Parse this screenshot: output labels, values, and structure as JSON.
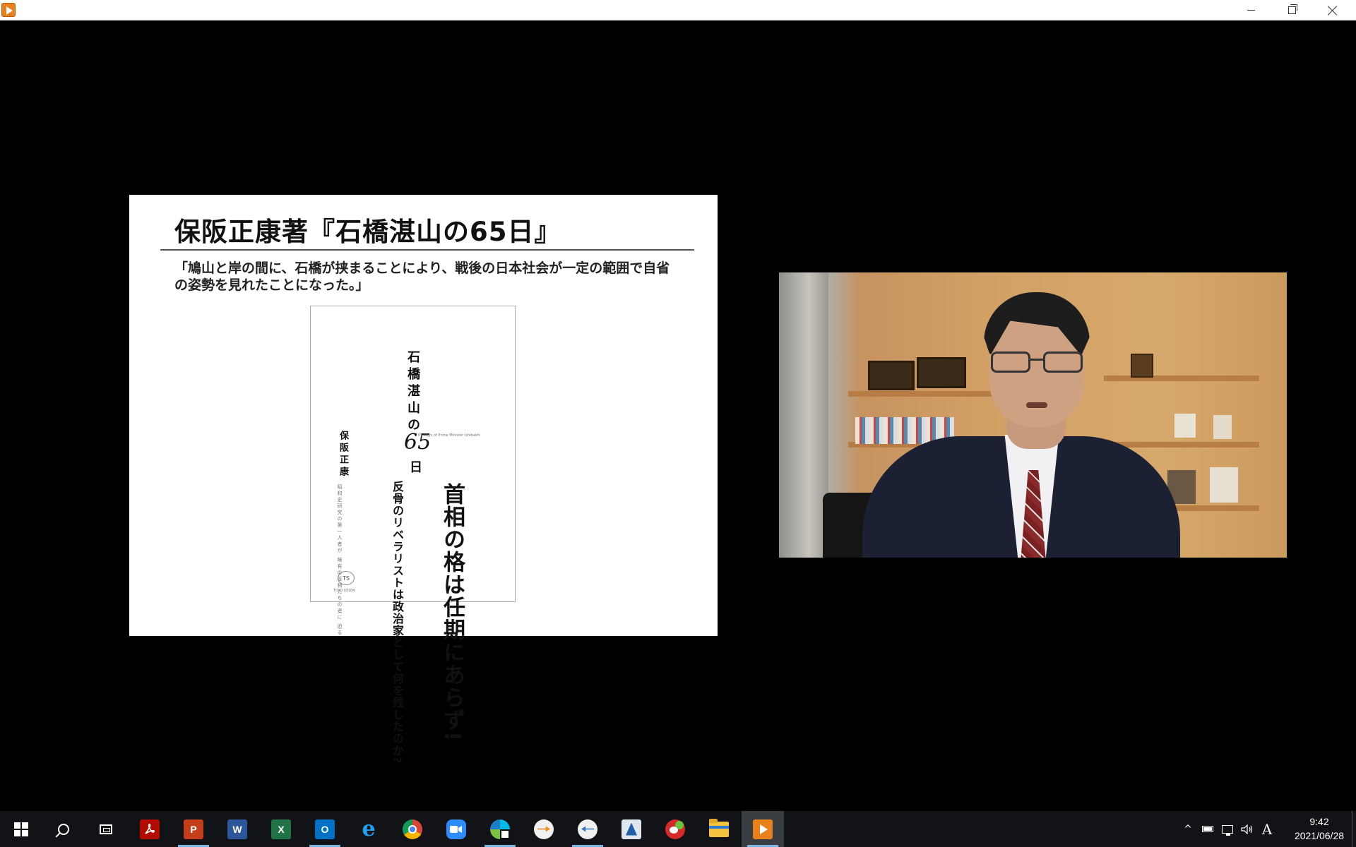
{
  "window": {
    "minimize_icon": "minimize-icon",
    "maximize_icon": "restore-icon",
    "close_icon": "close-icon"
  },
  "slide": {
    "title": "保阪正康著『石橋湛山の65日』",
    "quote": "「鳩山と岸の間に、石橋が挟まることにより、戦後の日本社会が一定の範囲で自省の姿勢を見れたことになった。」",
    "book": {
      "title": "石橋湛山の",
      "number": "65",
      "day": "日",
      "english": "65 Days of Prime Minister Ishibashi",
      "author": "保阪正康",
      "tagline": "昭和史研究の第一人者が 稀有の首相たちの姿に 迫る",
      "headline": "首相の格は任期にあらず!",
      "subtitle": "反骨のリベラリストは政治家として何を残したのか?",
      "logo": "TS",
      "publisher": "TOYO KEIZAI"
    }
  },
  "taskbar": {
    "apps": [
      {
        "name": "start-button",
        "icon": "windows-logo-icon"
      },
      {
        "name": "search-button",
        "icon": "search-icon"
      },
      {
        "name": "task-view-button",
        "icon": "task-view-icon"
      },
      {
        "name": "acrobat-button",
        "icon": "acrobat-icon",
        "color": "#b30b00"
      },
      {
        "name": "powerpoint-button",
        "icon": "powerpoint-icon",
        "color": "#c43e1c",
        "letter": "P"
      },
      {
        "name": "word-button",
        "icon": "word-icon",
        "color": "#2b579a",
        "letter": "W"
      },
      {
        "name": "excel-button",
        "icon": "excel-icon",
        "color": "#217346",
        "letter": "X"
      },
      {
        "name": "outlook-button",
        "icon": "outlook-icon",
        "color": "#0072c6",
        "letter": "O"
      },
      {
        "name": "edge-button",
        "icon": "internet-explorer-icon",
        "color": "#1ea1f1",
        "letter": "e"
      },
      {
        "name": "chrome-button",
        "icon": "chrome-icon"
      },
      {
        "name": "zoom-button",
        "icon": "zoom-icon",
        "color": "#2d8cff"
      },
      {
        "name": "webex-button",
        "icon": "webex-icon"
      },
      {
        "name": "app-arrow-orange-button",
        "icon": "arrow-orange-icon"
      },
      {
        "name": "app-arrow-blue-button",
        "icon": "arrow-blue-icon"
      },
      {
        "name": "app-blue-triangle-button",
        "icon": "triangle-app-icon"
      },
      {
        "name": "app-chat-button",
        "icon": "chat-app-icon"
      },
      {
        "name": "file-explorer-button",
        "icon": "folder-icon",
        "color": "#f3c33f"
      },
      {
        "name": "media-player-button",
        "icon": "media-player-icon",
        "color": "#e8811c"
      }
    ],
    "tray": {
      "chevron": "^",
      "ime": "A"
    },
    "clock": {
      "time": "9:42",
      "date": "2021/06/28"
    }
  }
}
